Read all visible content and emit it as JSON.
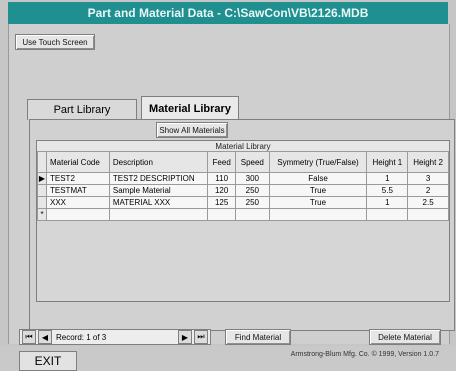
{
  "window": {
    "title": "Part and Material Data - C:\\SawCon\\VB\\2126.MDB"
  },
  "top": {
    "use_touch_screen": "Use Touch Screen"
  },
  "tabs": [
    {
      "label": "Part Library"
    },
    {
      "label": "Material Library"
    }
  ],
  "actions": {
    "show_all_materials": "Show All Materials",
    "find_material": "Find Material",
    "delete_material": "Delete Material"
  },
  "grid": {
    "title": "Material Library",
    "headers": [
      "Material Code",
      "Description",
      "Feed",
      "Speed",
      "Symmetry (True/False)",
      "Height 1",
      "Height 2"
    ],
    "rows": [
      {
        "marker": "▶",
        "code": "TEST2",
        "desc": "TEST2 DESCRIPTION",
        "feed": "110",
        "speed": "300",
        "sym": "False",
        "h1": "1",
        "h2": "3"
      },
      {
        "marker": "",
        "code": "TESTMAT",
        "desc": "Sample Material",
        "feed": "120",
        "speed": "250",
        "sym": "True",
        "h1": "5.5",
        "h2": "2"
      },
      {
        "marker": "",
        "code": "XXX",
        "desc": "MATERIAL XXX",
        "feed": "125",
        "speed": "250",
        "sym": "True",
        "h1": "1",
        "h2": "2.5"
      },
      {
        "marker": "*",
        "code": "",
        "desc": "",
        "feed": "",
        "speed": "",
        "sym": "",
        "h1": "",
        "h2": ""
      }
    ]
  },
  "footer": {
    "record_text": "Record: 1 of 3",
    "exit": "EXIT",
    "status": "Armstrong-Blum Mfg. Co. © 1999, Version 1.0.7"
  }
}
